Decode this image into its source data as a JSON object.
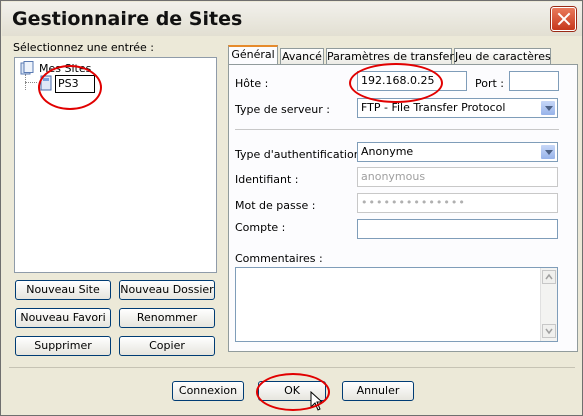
{
  "window": {
    "title": "Gestionnaire de Sites"
  },
  "left": {
    "select_label": "Sélectionnez une entrée :",
    "tree": {
      "root_label": "Mes Sites",
      "editing_value": "PS3"
    },
    "buttons": {
      "new_site": "Nouveau Site",
      "new_folder": "Nouveau Dossier",
      "new_bookmark": "Nouveau Favori",
      "rename": "Renommer",
      "delete": "Supprimer",
      "copy": "Copier"
    }
  },
  "tabs": [
    "Général",
    "Avancé",
    "Paramètres de transfert",
    "Jeu de caractères"
  ],
  "general": {
    "host_label": "Hôte :",
    "host_value": "192.168.0.25",
    "port_label": "Port :",
    "port_value": "",
    "server_type_label": "Type de serveur :",
    "server_type_value": "FTP - File Transfer Protocol",
    "auth_type_label": "Type d'authentification :",
    "auth_type_value": "Anonyme",
    "user_label": "Identifiant :",
    "user_value": "anonymous",
    "password_label": "Mot de passe :",
    "password_value": "••••••••••••••",
    "account_label": "Compte :",
    "account_value": "",
    "comments_label": "Commentaires :",
    "comments_value": ""
  },
  "footer": {
    "connect": "Connexion",
    "ok": "OK",
    "cancel": "Annuler"
  },
  "annotation_color": "#e10000"
}
